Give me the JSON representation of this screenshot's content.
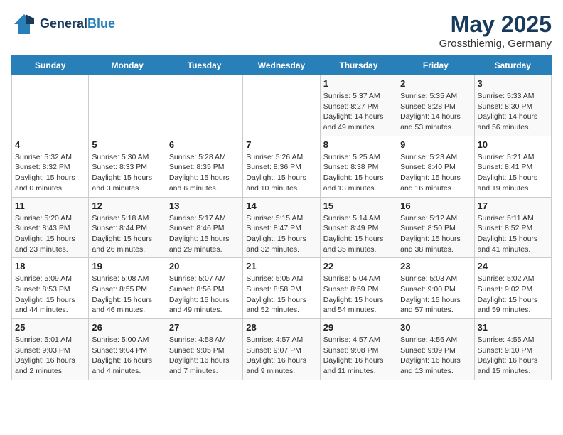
{
  "header": {
    "logo_line1": "General",
    "logo_line2": "Blue",
    "title": "May 2025",
    "subtitle": "Grossthiemig, Germany"
  },
  "days_of_week": [
    "Sunday",
    "Monday",
    "Tuesday",
    "Wednesday",
    "Thursday",
    "Friday",
    "Saturday"
  ],
  "weeks": [
    [
      {
        "day": "",
        "info": ""
      },
      {
        "day": "",
        "info": ""
      },
      {
        "day": "",
        "info": ""
      },
      {
        "day": "",
        "info": ""
      },
      {
        "day": "1",
        "info": "Sunrise: 5:37 AM\nSunset: 8:27 PM\nDaylight: 14 hours\nand 49 minutes."
      },
      {
        "day": "2",
        "info": "Sunrise: 5:35 AM\nSunset: 8:28 PM\nDaylight: 14 hours\nand 53 minutes."
      },
      {
        "day": "3",
        "info": "Sunrise: 5:33 AM\nSunset: 8:30 PM\nDaylight: 14 hours\nand 56 minutes."
      }
    ],
    [
      {
        "day": "4",
        "info": "Sunrise: 5:32 AM\nSunset: 8:32 PM\nDaylight: 15 hours\nand 0 minutes."
      },
      {
        "day": "5",
        "info": "Sunrise: 5:30 AM\nSunset: 8:33 PM\nDaylight: 15 hours\nand 3 minutes."
      },
      {
        "day": "6",
        "info": "Sunrise: 5:28 AM\nSunset: 8:35 PM\nDaylight: 15 hours\nand 6 minutes."
      },
      {
        "day": "7",
        "info": "Sunrise: 5:26 AM\nSunset: 8:36 PM\nDaylight: 15 hours\nand 10 minutes."
      },
      {
        "day": "8",
        "info": "Sunrise: 5:25 AM\nSunset: 8:38 PM\nDaylight: 15 hours\nand 13 minutes."
      },
      {
        "day": "9",
        "info": "Sunrise: 5:23 AM\nSunset: 8:40 PM\nDaylight: 15 hours\nand 16 minutes."
      },
      {
        "day": "10",
        "info": "Sunrise: 5:21 AM\nSunset: 8:41 PM\nDaylight: 15 hours\nand 19 minutes."
      }
    ],
    [
      {
        "day": "11",
        "info": "Sunrise: 5:20 AM\nSunset: 8:43 PM\nDaylight: 15 hours\nand 23 minutes."
      },
      {
        "day": "12",
        "info": "Sunrise: 5:18 AM\nSunset: 8:44 PM\nDaylight: 15 hours\nand 26 minutes."
      },
      {
        "day": "13",
        "info": "Sunrise: 5:17 AM\nSunset: 8:46 PM\nDaylight: 15 hours\nand 29 minutes."
      },
      {
        "day": "14",
        "info": "Sunrise: 5:15 AM\nSunset: 8:47 PM\nDaylight: 15 hours\nand 32 minutes."
      },
      {
        "day": "15",
        "info": "Sunrise: 5:14 AM\nSunset: 8:49 PM\nDaylight: 15 hours\nand 35 minutes."
      },
      {
        "day": "16",
        "info": "Sunrise: 5:12 AM\nSunset: 8:50 PM\nDaylight: 15 hours\nand 38 minutes."
      },
      {
        "day": "17",
        "info": "Sunrise: 5:11 AM\nSunset: 8:52 PM\nDaylight: 15 hours\nand 41 minutes."
      }
    ],
    [
      {
        "day": "18",
        "info": "Sunrise: 5:09 AM\nSunset: 8:53 PM\nDaylight: 15 hours\nand 44 minutes."
      },
      {
        "day": "19",
        "info": "Sunrise: 5:08 AM\nSunset: 8:55 PM\nDaylight: 15 hours\nand 46 minutes."
      },
      {
        "day": "20",
        "info": "Sunrise: 5:07 AM\nSunset: 8:56 PM\nDaylight: 15 hours\nand 49 minutes."
      },
      {
        "day": "21",
        "info": "Sunrise: 5:05 AM\nSunset: 8:58 PM\nDaylight: 15 hours\nand 52 minutes."
      },
      {
        "day": "22",
        "info": "Sunrise: 5:04 AM\nSunset: 8:59 PM\nDaylight: 15 hours\nand 54 minutes."
      },
      {
        "day": "23",
        "info": "Sunrise: 5:03 AM\nSunset: 9:00 PM\nDaylight: 15 hours\nand 57 minutes."
      },
      {
        "day": "24",
        "info": "Sunrise: 5:02 AM\nSunset: 9:02 PM\nDaylight: 15 hours\nand 59 minutes."
      }
    ],
    [
      {
        "day": "25",
        "info": "Sunrise: 5:01 AM\nSunset: 9:03 PM\nDaylight: 16 hours\nand 2 minutes."
      },
      {
        "day": "26",
        "info": "Sunrise: 5:00 AM\nSunset: 9:04 PM\nDaylight: 16 hours\nand 4 minutes."
      },
      {
        "day": "27",
        "info": "Sunrise: 4:58 AM\nSunset: 9:05 PM\nDaylight: 16 hours\nand 7 minutes."
      },
      {
        "day": "28",
        "info": "Sunrise: 4:57 AM\nSunset: 9:07 PM\nDaylight: 16 hours\nand 9 minutes."
      },
      {
        "day": "29",
        "info": "Sunrise: 4:57 AM\nSunset: 9:08 PM\nDaylight: 16 hours\nand 11 minutes."
      },
      {
        "day": "30",
        "info": "Sunrise: 4:56 AM\nSunset: 9:09 PM\nDaylight: 16 hours\nand 13 minutes."
      },
      {
        "day": "31",
        "info": "Sunrise: 4:55 AM\nSunset: 9:10 PM\nDaylight: 16 hours\nand 15 minutes."
      }
    ]
  ]
}
